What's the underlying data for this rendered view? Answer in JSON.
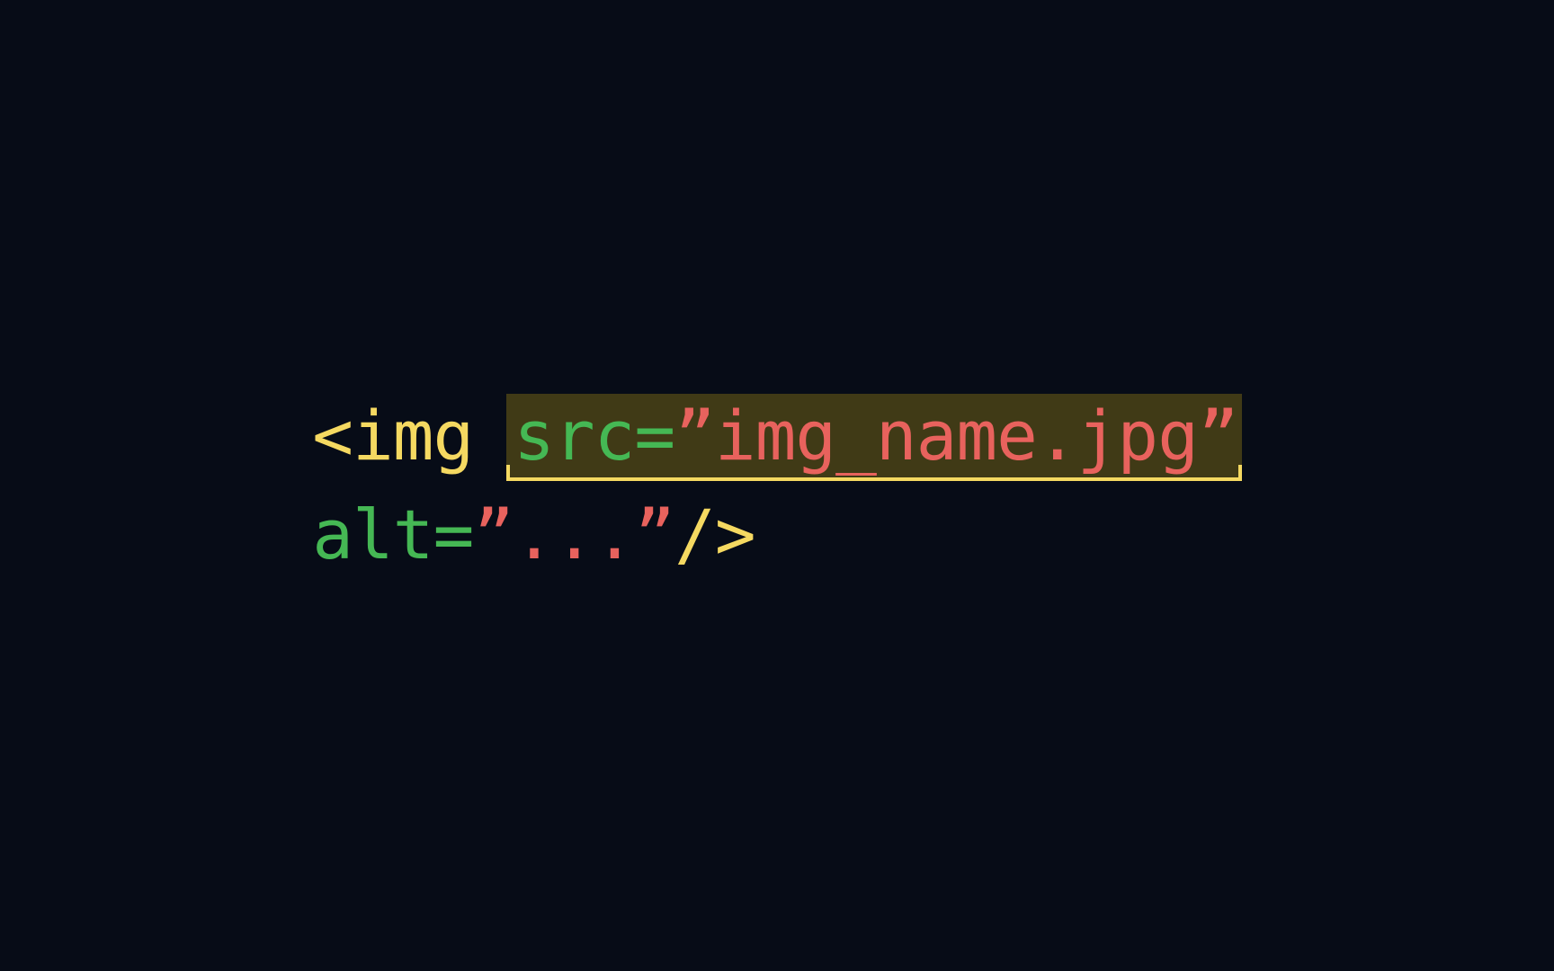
{
  "code": {
    "line1": {
      "tagOpen": "<img ",
      "srcAttr": "src",
      "srcEquals": "=",
      "srcQuoteOpen": "”",
      "srcValue": "img_name.jpg",
      "srcQuoteClose": "”"
    },
    "line2": {
      "altAttr": "alt",
      "altEquals": "=",
      "altQuoteOpen": "”",
      "altValue": "...",
      "altQuoteClose": "”",
      "tagClose": "/>"
    }
  },
  "colors": {
    "background": "#070C17",
    "tag": "#F5D961",
    "attribute": "#45B854",
    "string": "#E8625D",
    "highlightBg": "#403A16",
    "highlightBorder": "#F5D961"
  }
}
